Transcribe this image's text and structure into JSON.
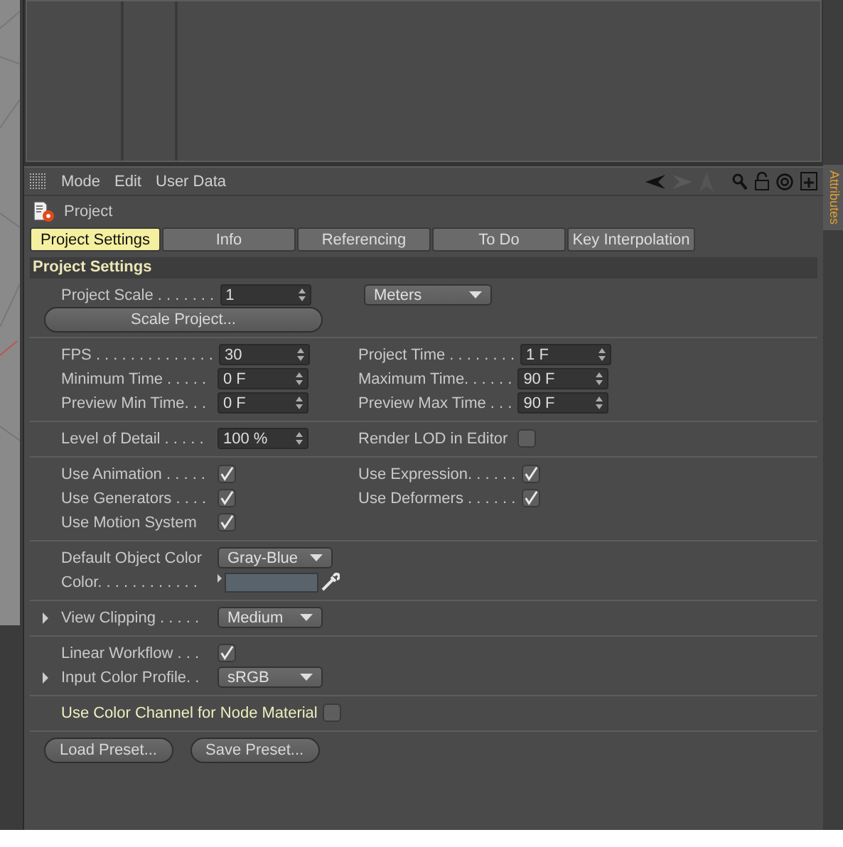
{
  "menu": [
    "Mode",
    "Edit",
    "User Data"
  ],
  "object": {
    "name": "Project"
  },
  "tabs": [
    {
      "label": "Project Settings",
      "selected": true
    },
    {
      "label": "Info",
      "selected": false
    },
    {
      "label": "Referencing",
      "selected": false
    },
    {
      "label": "To Do",
      "selected": false
    },
    {
      "label": "Key Interpolation",
      "selected": false
    }
  ],
  "section_title": "Project Settings",
  "groups": [
    {
      "rows": [
        {
          "cells": [
            {
              "kind": "number",
              "label": "Project Scale . . . . . . .",
              "value": "1"
            },
            {
              "kind": "dropdown",
              "value": "Meters"
            }
          ]
        },
        {
          "cells": [
            {
              "kind": "button",
              "label": "Scale Project..."
            }
          ]
        }
      ]
    },
    {
      "rows": [
        {
          "cells": [
            {
              "kind": "number",
              "label": "FPS . . . . . . . . . . . . . .",
              "value": "30"
            },
            {
              "kind": "number",
              "label": "Project Time . . . . . . . .",
              "value": "1 F"
            }
          ]
        },
        {
          "cells": [
            {
              "kind": "number",
              "label": "Minimum Time . . . . .",
              "value": "0 F"
            },
            {
              "kind": "number",
              "label": "Maximum Time. . . . . .",
              "value": "90 F"
            }
          ]
        },
        {
          "cells": [
            {
              "kind": "number",
              "label": "Preview Min Time. . .",
              "value": "0 F"
            },
            {
              "kind": "number",
              "label": "Preview Max Time . . .",
              "value": "90 F"
            }
          ]
        }
      ]
    },
    {
      "rows": [
        {
          "cells": [
            {
              "kind": "number",
              "label": "Level of Detail . . . . .",
              "value": "100 %"
            },
            {
              "kind": "checkbox",
              "label": "Render LOD in Editor",
              "checked": false,
              "highlighted": false
            }
          ]
        }
      ]
    },
    {
      "rows": [
        {
          "cells": [
            {
              "kind": "checkbox",
              "label": "Use Animation . . . . .",
              "checked": true,
              "highlighted": false
            },
            {
              "kind": "checkbox",
              "label": "Use Expression. . . . . .",
              "checked": true,
              "highlighted": false
            }
          ]
        },
        {
          "cells": [
            {
              "kind": "checkbox",
              "label": "Use Generators . . . .",
              "checked": true,
              "highlighted": false
            },
            {
              "kind": "checkbox",
              "label": "Use Deformers . . . . . .",
              "checked": true,
              "highlighted": false
            }
          ]
        },
        {
          "cells": [
            {
              "kind": "checkbox",
              "label": "Use Motion System",
              "checked": true,
              "highlighted": false
            }
          ]
        }
      ]
    },
    {
      "rows": [
        {
          "cells": [
            {
              "kind": "dropdown",
              "label": "Default Object Color",
              "value": "Gray-Blue"
            }
          ]
        },
        {
          "cells": [
            {
              "kind": "color",
              "label": "Color. . . . . . . . . . . .",
              "color": "#59636c"
            }
          ]
        }
      ]
    },
    {
      "rows": [
        {
          "expanded": false,
          "cells": [
            {
              "kind": "dropdown",
              "label": "View Clipping . . . . .",
              "value": "Medium"
            }
          ]
        }
      ]
    },
    {
      "rows": [
        {
          "cells": [
            {
              "kind": "checkbox",
              "label": "Linear Workflow . . .",
              "checked": true,
              "highlighted": false
            }
          ]
        },
        {
          "expanded": false,
          "cells": [
            {
              "kind": "dropdown",
              "label": "Input Color Profile. .",
              "value": "sRGB"
            }
          ]
        }
      ]
    },
    {
      "rows": [
        {
          "cells": [
            {
              "kind": "checkbox",
              "label": "Use Color Channel for Node Material",
              "checked": false,
              "highlighted": true
            }
          ]
        }
      ]
    }
  ],
  "presets": [
    "Load Preset...",
    "Save Preset..."
  ],
  "side_tab": "Attributes"
}
